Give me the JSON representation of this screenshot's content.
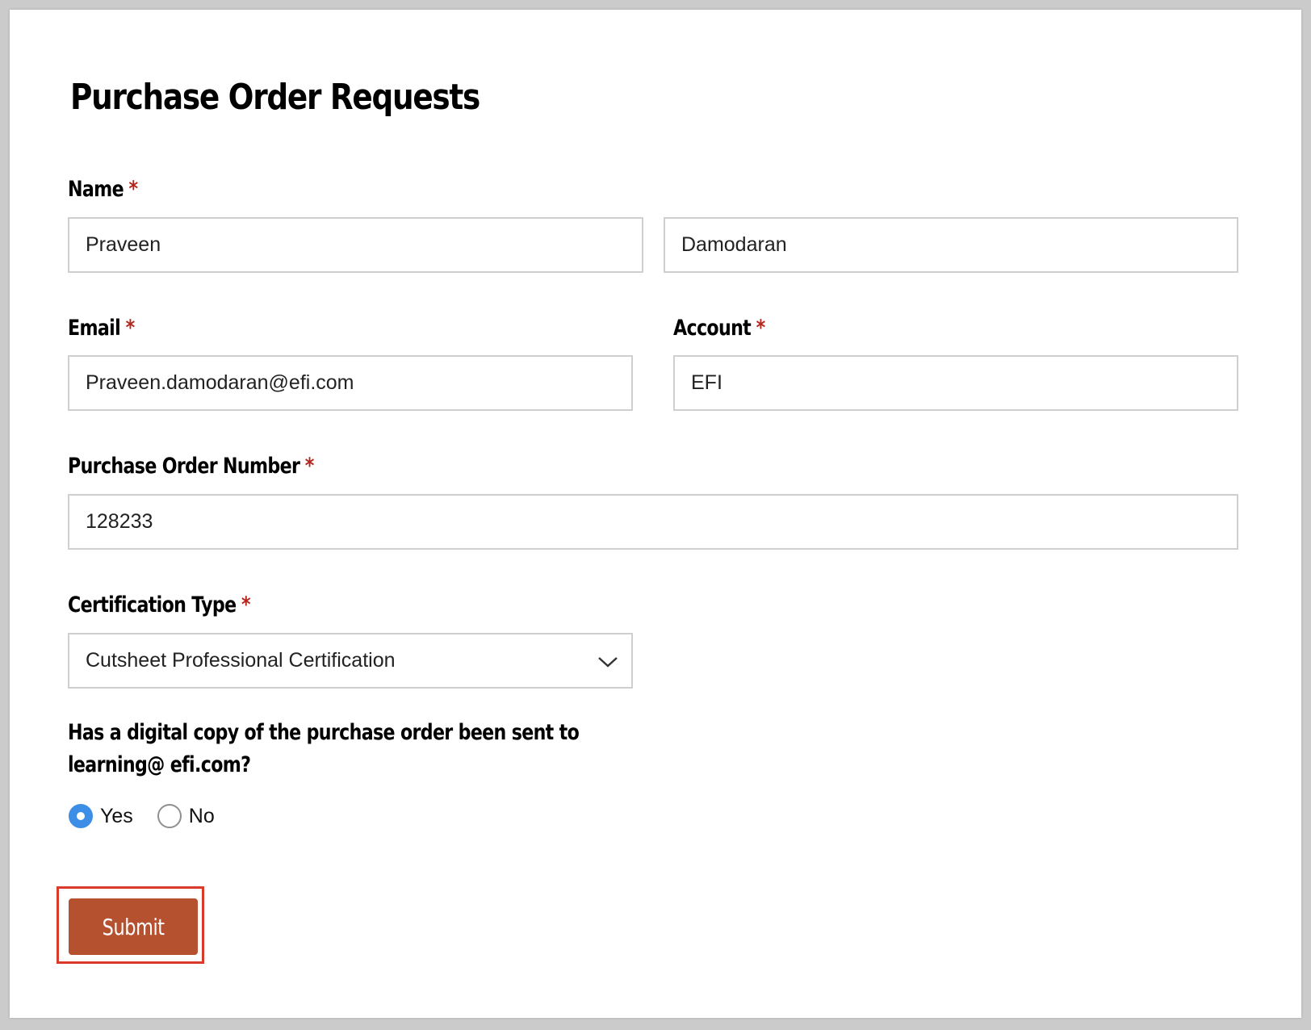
{
  "page": {
    "title": "Purchase Order Requests"
  },
  "form": {
    "required_marker": "*",
    "name": {
      "label": "Name",
      "first_value": "Praveen",
      "last_value": "Damodaran"
    },
    "email": {
      "label": "Email",
      "value": "Praveen.damodaran@efi.com"
    },
    "account": {
      "label": "Account",
      "value": "EFI"
    },
    "po_number": {
      "label": "Purchase Order Number",
      "value": "128233"
    },
    "certification": {
      "label": "Certification Type",
      "selected": "Cutsheet Professional Certification"
    },
    "digital_copy": {
      "question": "Has a digital copy of the purchase order been sent to learning@ efi.com?",
      "options": [
        {
          "label": "Yes",
          "checked": true
        },
        {
          "label": "No",
          "checked": false
        }
      ]
    },
    "submit_label": "Submit"
  },
  "colors": {
    "required": "#b5251c",
    "submit_bg": "#b5512f",
    "radio_checked": "#3d8ee6",
    "highlight_border": "#d93a2b"
  }
}
